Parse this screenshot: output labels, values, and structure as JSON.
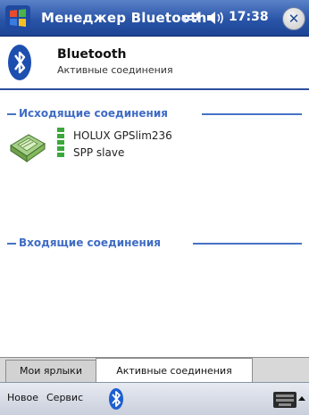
{
  "titlebar": {
    "title": "Менеджер Bluetooth",
    "time": "17:38",
    "close_icon": "close-icon"
  },
  "header": {
    "title": "Bluetooth",
    "subtitle": "Активные соединения"
  },
  "outgoing": {
    "label": "Исходящие соединения",
    "devices": [
      {
        "name": "HOLUX GPSlim236",
        "profile": "SPP slave",
        "icon": "gps-device-icon",
        "signal_bars": 5
      }
    ]
  },
  "incoming": {
    "label": "Входящие соединения"
  },
  "tabs": [
    {
      "label": "Мои ярлыки",
      "active": false
    },
    {
      "label": "Активные соединения",
      "active": true
    }
  ],
  "menubar": {
    "left_label": "Новое",
    "right_label": "Сервис",
    "bluetooth_icon": "bluetooth-icon",
    "keyboard_icon": "keyboard-icon"
  },
  "colors": {
    "titlebar": "#2a55a8",
    "section_label": "#3f6cc4",
    "signal": "#3aa83a"
  }
}
